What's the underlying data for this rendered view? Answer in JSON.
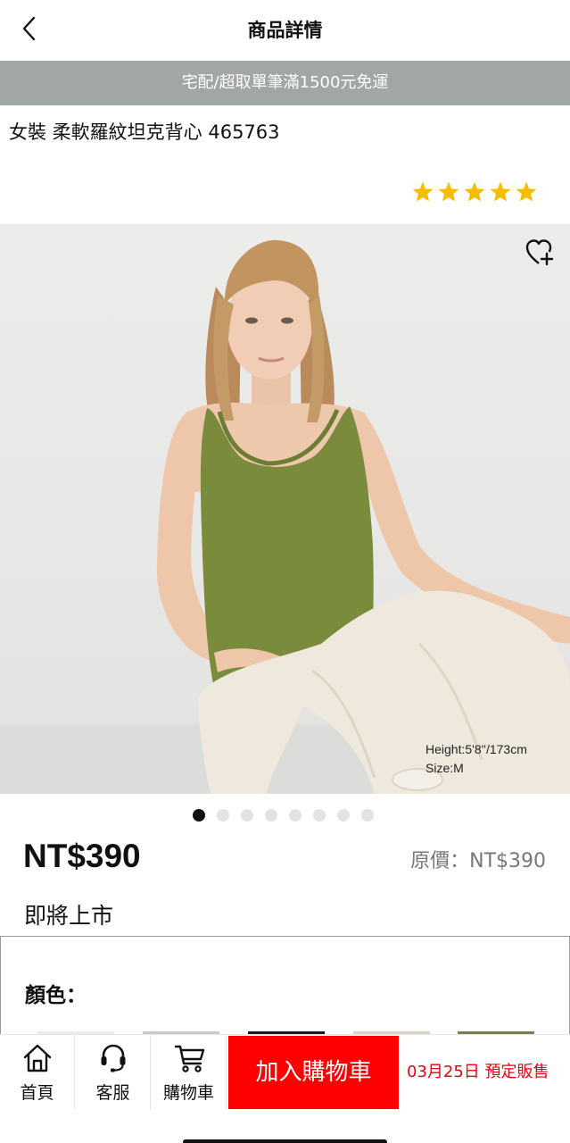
{
  "header": {
    "title": "商品詳情",
    "back_icon": "chevron-left-icon"
  },
  "promo": {
    "text": "宅配/超取單筆滿1500元免運",
    "background": "#a3a6a7"
  },
  "product": {
    "title": "女裝 柔軟羅紋坦克背心 465763",
    "rating_stars": 5,
    "rating_color": "#f5bd00",
    "model_height": "Height:5'8''/173cm",
    "model_size": "Size:M",
    "image_count": 8,
    "image_index": 1,
    "price": "NT$390",
    "original_price": "原價：NT$390",
    "status": "即將上市",
    "color_label": "顏色：",
    "swatch_colors": [
      "#efece6",
      "#c9c9c6",
      "#1a1a1a",
      "#ddd3c5",
      "#7c8040"
    ]
  },
  "nav": {
    "home": "首頁",
    "service": "客服",
    "cart": "購物車",
    "add_to_cart": "加入購物車",
    "presale": "03月25日 預定販售"
  },
  "colors": {
    "accent": "#ff0000",
    "presale": "#e60012",
    "product_green": "#7a8c3c"
  }
}
